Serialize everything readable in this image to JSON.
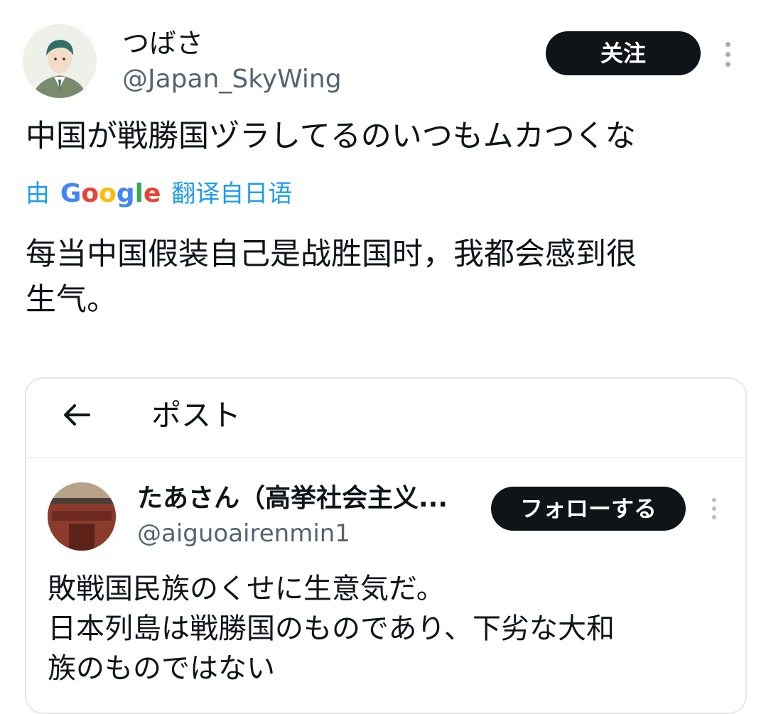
{
  "tweet": {
    "display_name": "つばさ",
    "handle": "@Japan_SkyWing",
    "follow_label": "关注",
    "text": "中国が戦勝国ヅラしてるのいつもムカつくな",
    "translate_prefix": "由",
    "translate_brand": "Google",
    "translate_suffix": "翻译自日语",
    "translation_line1": "每当中国假装自己是战胜国时，我都会感到很",
    "translation_line2": "生气。"
  },
  "embedded_post": {
    "back_icon": "arrow-left-icon",
    "title": "ポスト",
    "display_name": "たあさん（高挙社会主义...",
    "handle": "@aiguoairenmin1",
    "follow_label": "フォローする",
    "text_line1": "敗戦国民族のくせに生意気だ。",
    "text_line2": "日本列島は戦勝国のものであり、下劣な大和",
    "text_line3": "族のものではない"
  },
  "colors": {
    "button_bg": "#0f1419",
    "handle_gray": "#536471",
    "link_blue": "#1d9bf0",
    "border": "#e4e7ea"
  }
}
